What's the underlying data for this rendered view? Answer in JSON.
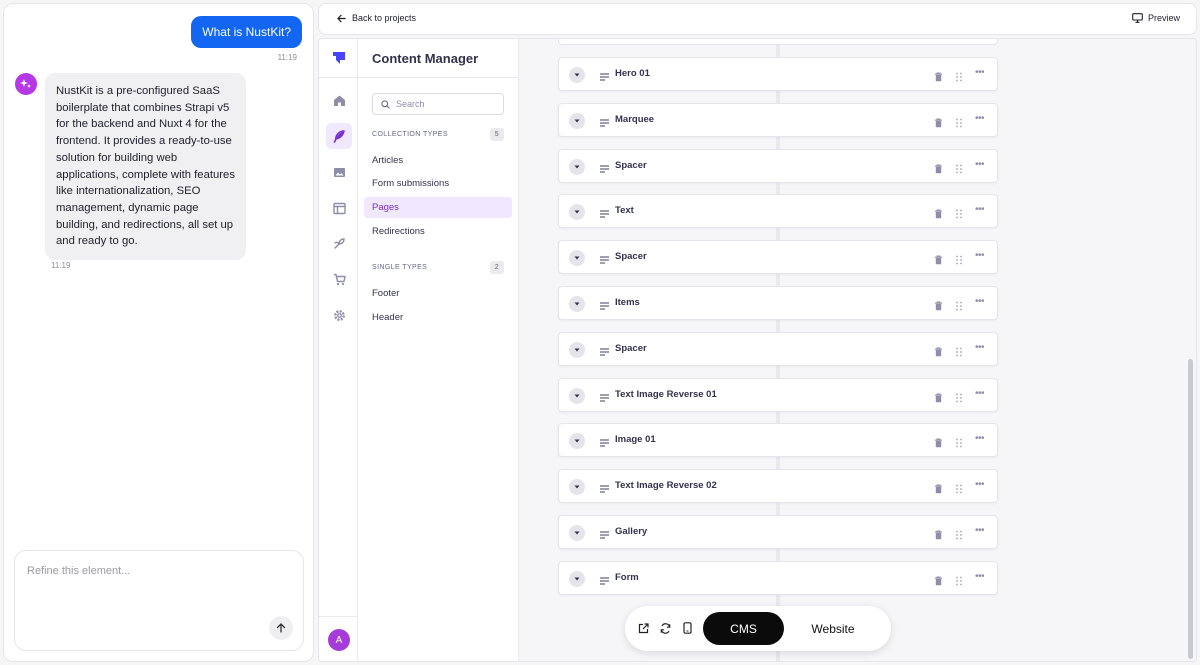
{
  "chat": {
    "user_message": "What is NustKit?",
    "user_time": "11:19",
    "bot_message": "NustKit is a pre-configured SaaS boilerplate that combines Strapi v5 for the backend and Nuxt 4 for the frontend. It provides a ready-to-use solution for building web applications, complete with features like internationalization, SEO management, dynamic page building, and redirections, all set up and ready to go.",
    "bot_time": "11:19",
    "refine_placeholder": "Refine this element..."
  },
  "topbar": {
    "back_label": "Back to projects",
    "preview_label": "Preview"
  },
  "rail": {
    "user_initial": "A"
  },
  "content_manager": {
    "title": "Content Manager",
    "search_placeholder": "Search",
    "collection_types_label": "COLLECTION TYPES",
    "collection_types_count": "5",
    "collection_items": [
      "Articles",
      "Form submissions",
      "Pages",
      "Redirections"
    ],
    "active_item": "Pages",
    "single_types_label": "SINGLE TYPES",
    "single_types_count": "2",
    "single_items": [
      "Footer",
      "Header"
    ]
  },
  "blocks": [
    "Hero 01",
    "Marquee",
    "Spacer",
    "Text",
    "Spacer",
    "Items",
    "Spacer",
    "Text Image Reverse 01",
    "Image 01",
    "Text Image Reverse 02",
    "Gallery",
    "Form"
  ],
  "bottom_bar": {
    "cms_label": "CMS",
    "website_label": "Website",
    "active": "CMS"
  },
  "colors": {
    "accent": "#7b2fcf",
    "user_bubble": "#1266f1",
    "bot_avatar": "#b537e6",
    "active_bg": "#f0e8ff"
  }
}
